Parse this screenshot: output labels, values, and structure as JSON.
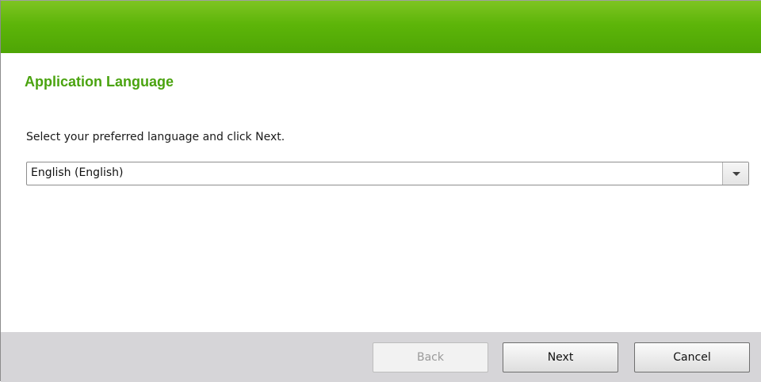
{
  "page": {
    "title": "Application Language",
    "instruction": "Select your preferred language and click Next."
  },
  "language_select": {
    "selected": "English (English)",
    "icon": "chevron-down-icon"
  },
  "footer": {
    "back_label": "Back",
    "back_enabled": false,
    "next_label": "Next",
    "cancel_label": "Cancel"
  },
  "colors": {
    "accent": "#5db509",
    "title": "#4aa30f",
    "footer_bg": "#d6d5d8"
  }
}
